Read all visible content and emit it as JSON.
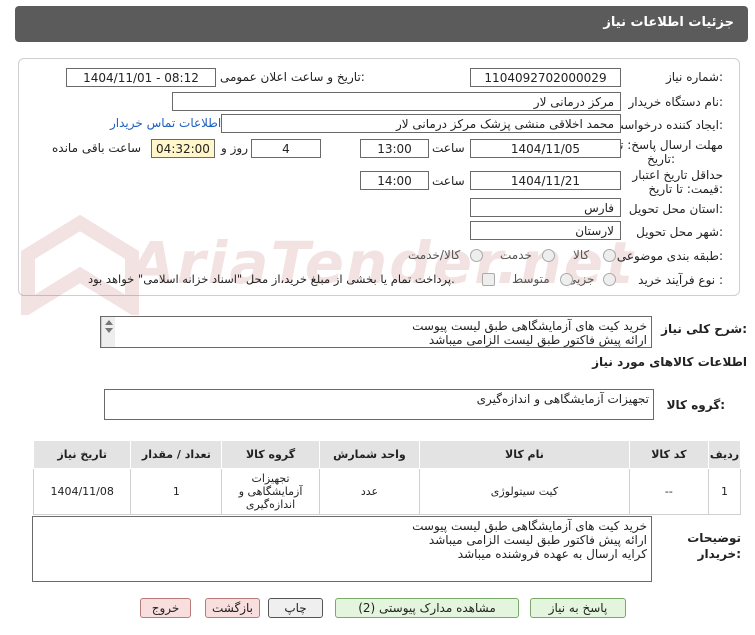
{
  "header": {
    "title": "جزئیات اطلاعات نیاز"
  },
  "form": {
    "need_number_label": "شماره نیاز:",
    "need_number": "1104092702000029",
    "announce_label": "تاریخ و ساعت اعلان عمومی:",
    "announce_value": "1404/11/01 - 08:12",
    "buyer_org_label": "نام دستگاه خریدار:",
    "buyer_org": "مرکز درمانی لار",
    "creator_label": "ایجاد کننده درخواست:",
    "creator": "محمد  اخلاقی منشی پزشک مرکز درمانی لار",
    "contact_link": "اطلاعات تماس خریدار",
    "deadline_label_1": "مهلت ارسال پاسخ: تا",
    "deadline_label_2": "تاریخ:",
    "deadline_date": "1404/11/05",
    "time_word": "ساعت",
    "deadline_time": "13:00",
    "days_value": "4",
    "days_word": "روز و",
    "remaining_time": "04:32:00",
    "remaining_word": "ساعت باقی مانده",
    "validity_label_1": "حداقل تاریخ اعتبار",
    "validity_label_2": "قیمت: تا تاریخ:",
    "validity_date": "1404/11/21",
    "validity_time": "14:00",
    "province_label": "استان محل تحویل:",
    "province": "فارس",
    "city_label": "شهر محل تحویل:",
    "city": "لارستان",
    "category_label": "طبقه بندی موضوعی:",
    "category_options": [
      "کالا",
      "خدمت",
      "کالا/خدمت"
    ],
    "process_label": "نوع فرآیند خرید :",
    "process_options": [
      "جزیی",
      "متوسط"
    ],
    "payment_note": "پرداخت تمام یا بخشی از مبلغ خرید،از محل \"اسناد خزانه اسلامی\" خواهد بود."
  },
  "description": {
    "label": "شرح کلی نیاز:",
    "lines": [
      "خرید کیت های آزمایشگاهی طبق لیست پیوست",
      "ارائه پیش فاکتور طبق لیست الزامی میباشد"
    ]
  },
  "goods": {
    "section_title": "اطلاعات کالاهای مورد نیاز",
    "group_label": "گروه کالا:",
    "group_value": "تجهیزات آزمایشگاهی و اندازه‌گیری"
  },
  "table": {
    "headers": [
      "ردیف",
      "کد کالا",
      "نام کالا",
      "واحد شمارش",
      "گروه کالا",
      "تعداد / مقدار",
      "تاریخ نیاز"
    ],
    "rows": [
      {
        "row": "1",
        "code": "--",
        "name": "کیت سیتولوژی",
        "unit": "عدد",
        "group": "تجهیزات آزمایشگاهی و اندازه‌گیری",
        "qty": "1",
        "date": "1404/11/08"
      }
    ]
  },
  "buyer_notes": {
    "label_1": "توضیحات",
    "label_2": "خریدار:",
    "lines": [
      "خرید کیت های آزمایشگاهی طبق لیست پیوست",
      "ارائه پیش فاکتور طبق لیست الزامی میباشد",
      "کرایه ارسال به عهده فروشنده میباشد"
    ]
  },
  "buttons": {
    "reply": "پاسخ به نیاز",
    "view_docs": "مشاهده مدارک پیوستی (2)",
    "print": "چاپ",
    "back": "بازگشت",
    "exit": "خروج"
  },
  "watermark": "AriaTender.net"
}
